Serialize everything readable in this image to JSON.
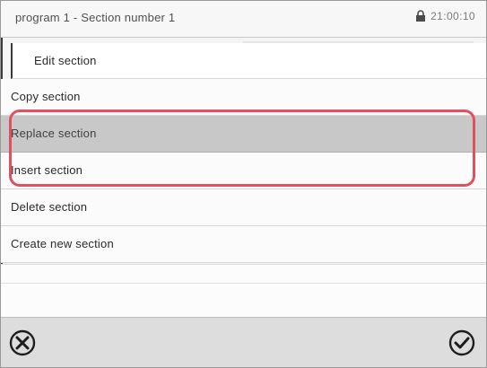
{
  "header": {
    "title": "program 1 - Section number 1",
    "time": "21:00:10",
    "status_icon": "lock-icon"
  },
  "menu": {
    "items": [
      {
        "label": "Edit section",
        "selected": false
      },
      {
        "label": "Copy section",
        "selected": false
      },
      {
        "label": "Replace section",
        "selected": true
      },
      {
        "label": "Insert section",
        "selected": false
      },
      {
        "label": "Delete section",
        "selected": false
      },
      {
        "label": "Create new section",
        "selected": false
      }
    ]
  },
  "footer": {
    "cancel_icon": "cancel-icon",
    "confirm_icon": "confirm-icon"
  },
  "colors": {
    "highlight": "#e0505d",
    "selected_row": "#c8c8c8"
  }
}
